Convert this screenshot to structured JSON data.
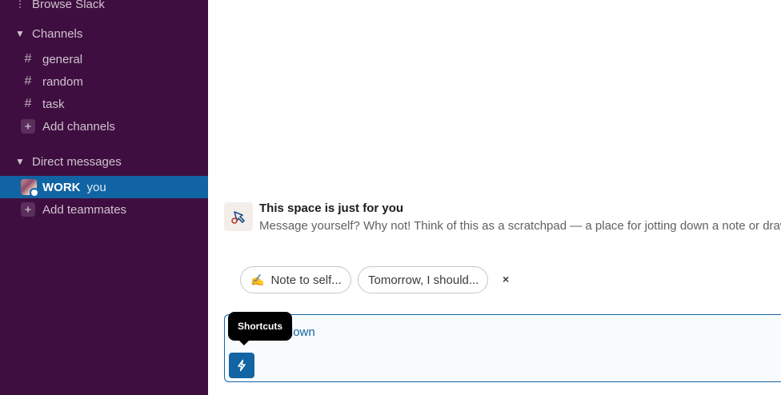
{
  "sidebar": {
    "browse_label": "Browse Slack",
    "channels_header": "Channels",
    "channels": [
      {
        "name": "general"
      },
      {
        "name": "random"
      },
      {
        "name": "task"
      }
    ],
    "add_channels_label": "Add channels",
    "dm_header": "Direct messages",
    "dm_self": {
      "name": "WORK",
      "suffix": "you"
    },
    "add_teammates_label": "Add teammates"
  },
  "main": {
    "intro_title": "This space is just for you",
    "intro_desc": "Message yourself? Why not! Think of this as a scratchpad — a place for jotting down a note or drawi",
    "suggestions": [
      {
        "emoji": "✍️",
        "label": "Note to self..."
      },
      {
        "label": "Tomorrow, I should..."
      }
    ],
    "dismiss_label": "×",
    "composer_text": "ng down",
    "tooltip": "Shortcuts"
  },
  "colors": {
    "sidebar_bg": "#3f0e40",
    "active_bg": "#1164a3",
    "accent": "#1264a3"
  },
  "icons": {
    "browse": "more-vertical-icon",
    "collapse": "caret-down-icon",
    "channel": "hash-icon",
    "add": "plus-icon",
    "intro": "scratchpad-icon",
    "shortcuts": "lightning-icon"
  }
}
